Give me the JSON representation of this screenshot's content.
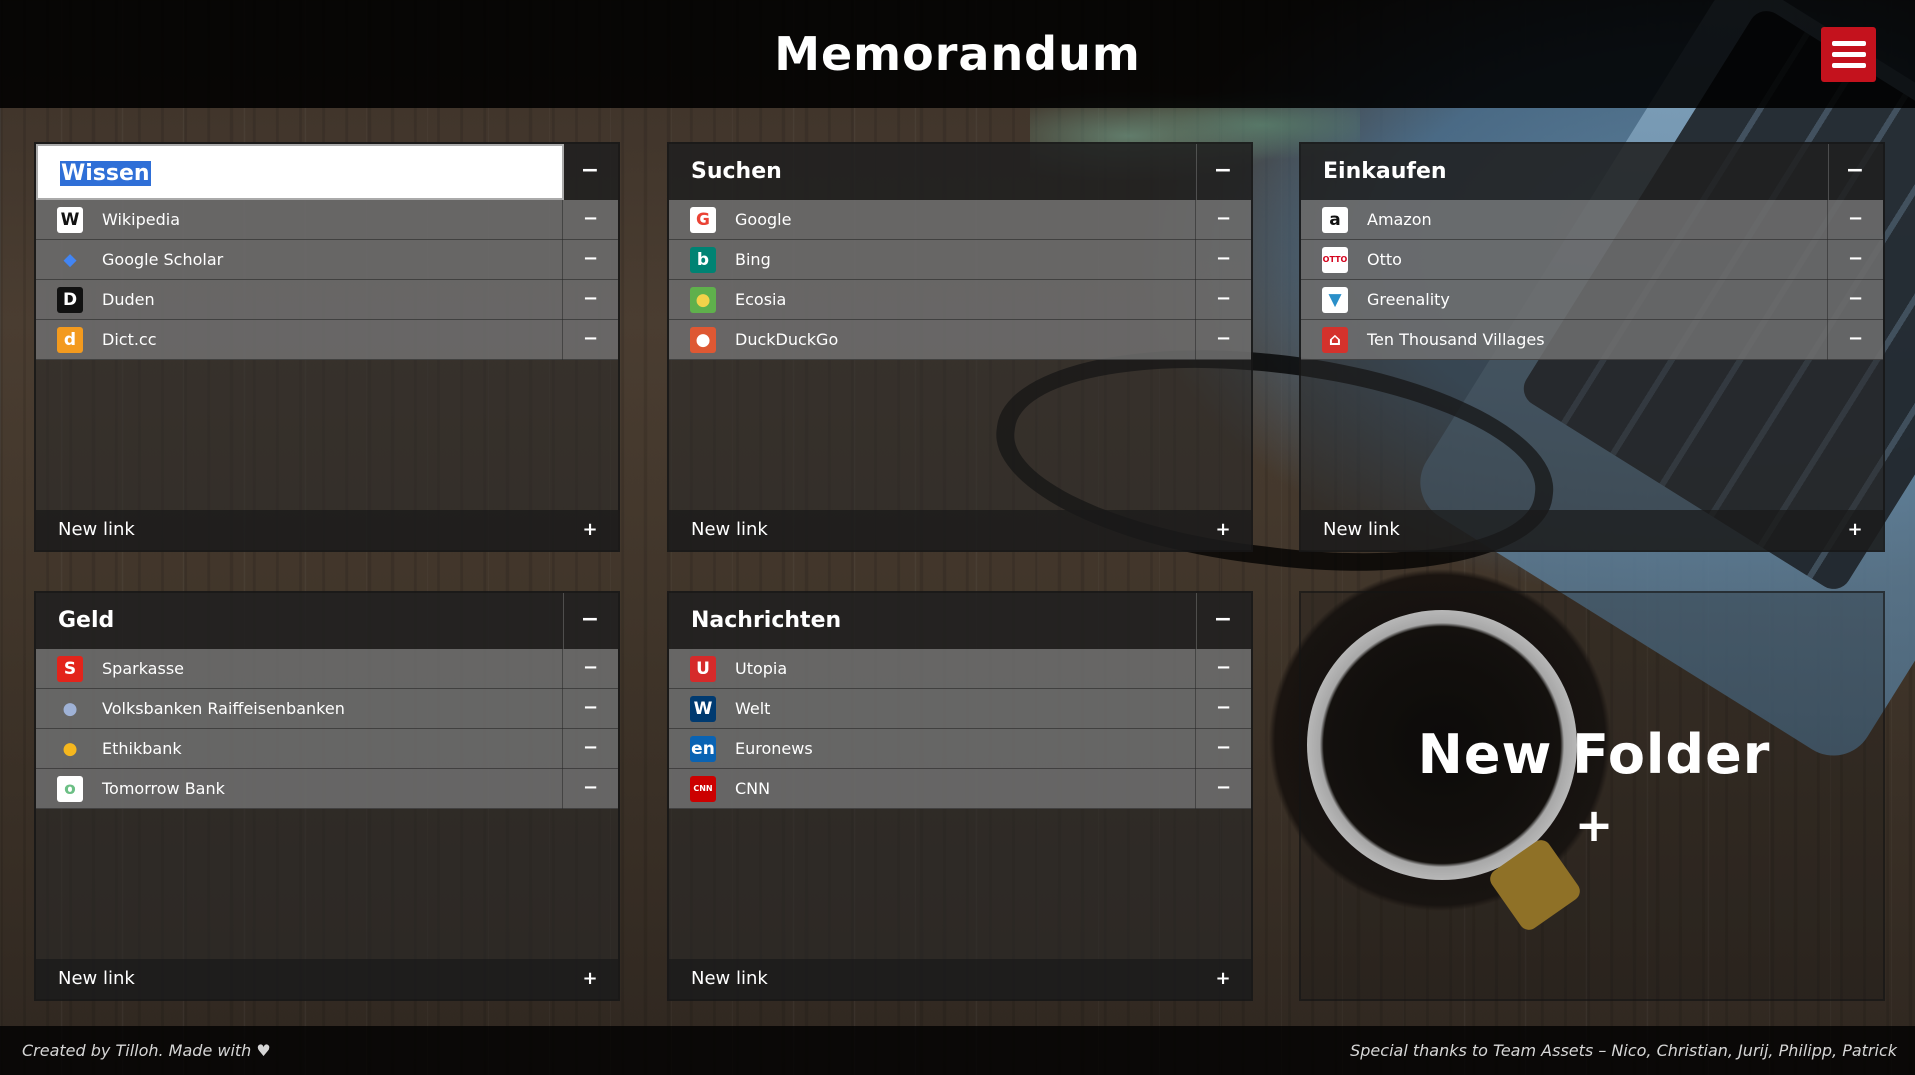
{
  "app": {
    "title": "Memorandum",
    "menu_icon": "hamburger-menu-icon"
  },
  "folders": [
    {
      "title": "Wissen",
      "editing": true,
      "links": [
        {
          "label": "Wikipedia",
          "icon": "wikipedia-icon",
          "glyph": "W",
          "bg": "#ffffff",
          "fg": "#111111"
        },
        {
          "label": "Google Scholar",
          "icon": "google-scholar-icon",
          "glyph": "◆",
          "bg": "transparent",
          "fg": "#4285f4"
        },
        {
          "label": "Duden",
          "icon": "duden-icon",
          "glyph": "D",
          "bg": "#111111",
          "fg": "#ffffff"
        },
        {
          "label": "Dict.cc",
          "icon": "dictcc-icon",
          "glyph": "d",
          "bg": "#f39a1e",
          "fg": "#ffffff"
        }
      ],
      "new_link": "New link"
    },
    {
      "title": "Suchen",
      "editing": false,
      "links": [
        {
          "label": "Google",
          "icon": "google-icon",
          "glyph": "G",
          "bg": "#ffffff",
          "fg": "#ea4335"
        },
        {
          "label": "Bing",
          "icon": "bing-icon",
          "glyph": "b",
          "bg": "#008373",
          "fg": "#ffffff"
        },
        {
          "label": "Ecosia",
          "icon": "ecosia-icon",
          "glyph": "●",
          "bg": "#5fb04c",
          "fg": "#f3d24a"
        },
        {
          "label": "DuckDuckGo",
          "icon": "duckduckgo-icon",
          "glyph": "●",
          "bg": "#de5833",
          "fg": "#ffffff"
        }
      ],
      "new_link": "New link"
    },
    {
      "title": "Einkaufen",
      "editing": false,
      "links": [
        {
          "label": "Amazon",
          "icon": "amazon-icon",
          "glyph": "a",
          "bg": "#ffffff",
          "fg": "#111111"
        },
        {
          "label": "Otto",
          "icon": "otto-icon",
          "glyph": "OTTO",
          "bg": "#ffffff",
          "fg": "#d4021d"
        },
        {
          "label": "Greenality",
          "icon": "greenality-icon",
          "glyph": "▼",
          "bg": "#ffffff",
          "fg": "#2a8fc9"
        },
        {
          "label": "Ten Thousand Villages",
          "icon": "ten-thousand-villages-icon",
          "glyph": "⌂",
          "bg": "#d4322c",
          "fg": "#ffffff"
        }
      ],
      "new_link": "New link"
    },
    {
      "title": "Geld",
      "editing": false,
      "links": [
        {
          "label": "Sparkasse",
          "icon": "sparkasse-icon",
          "glyph": "S",
          "bg": "#e3241b",
          "fg": "#ffffff"
        },
        {
          "label": "Volksbanken Raiffeisenbanken",
          "icon": "volksbanken-icon",
          "glyph": "●",
          "bg": "transparent",
          "fg": "#9fb2d6"
        },
        {
          "label": "Ethikbank",
          "icon": "ethikbank-icon",
          "glyph": "●",
          "bg": "transparent",
          "fg": "#f5b71e"
        },
        {
          "label": "Tomorrow Bank",
          "icon": "tomorrow-bank-icon",
          "glyph": "o",
          "bg": "#ffffff",
          "fg": "#6cbf85"
        }
      ],
      "new_link": "New link"
    },
    {
      "title": "Nachrichten",
      "editing": false,
      "links": [
        {
          "label": "Utopia",
          "icon": "utopia-icon",
          "glyph": "U",
          "bg": "#d62a2a",
          "fg": "#ffffff"
        },
        {
          "label": "Welt",
          "icon": "welt-icon",
          "glyph": "W",
          "bg": "#003a70",
          "fg": "#ffffff"
        },
        {
          "label": "Euronews",
          "icon": "euronews-icon",
          "glyph": "en",
          "bg": "#0a63b3",
          "fg": "#ffffff"
        },
        {
          "label": "CNN",
          "icon": "cnn-icon",
          "glyph": "CNN",
          "bg": "#cc0000",
          "fg": "#ffffff"
        }
      ],
      "new_link": "New link"
    }
  ],
  "new_folder": {
    "label": "New Folder",
    "add": "+"
  },
  "controls": {
    "minus": "−",
    "plus": "+"
  },
  "footer": {
    "left": "Created by Tilloh. Made with ♥",
    "right": "Special thanks to Team Assets – Nico, Christian, Jurij, Philipp, Patrick"
  },
  "colors": {
    "accent": "#c4121d",
    "selection": "#2f6fd7"
  }
}
